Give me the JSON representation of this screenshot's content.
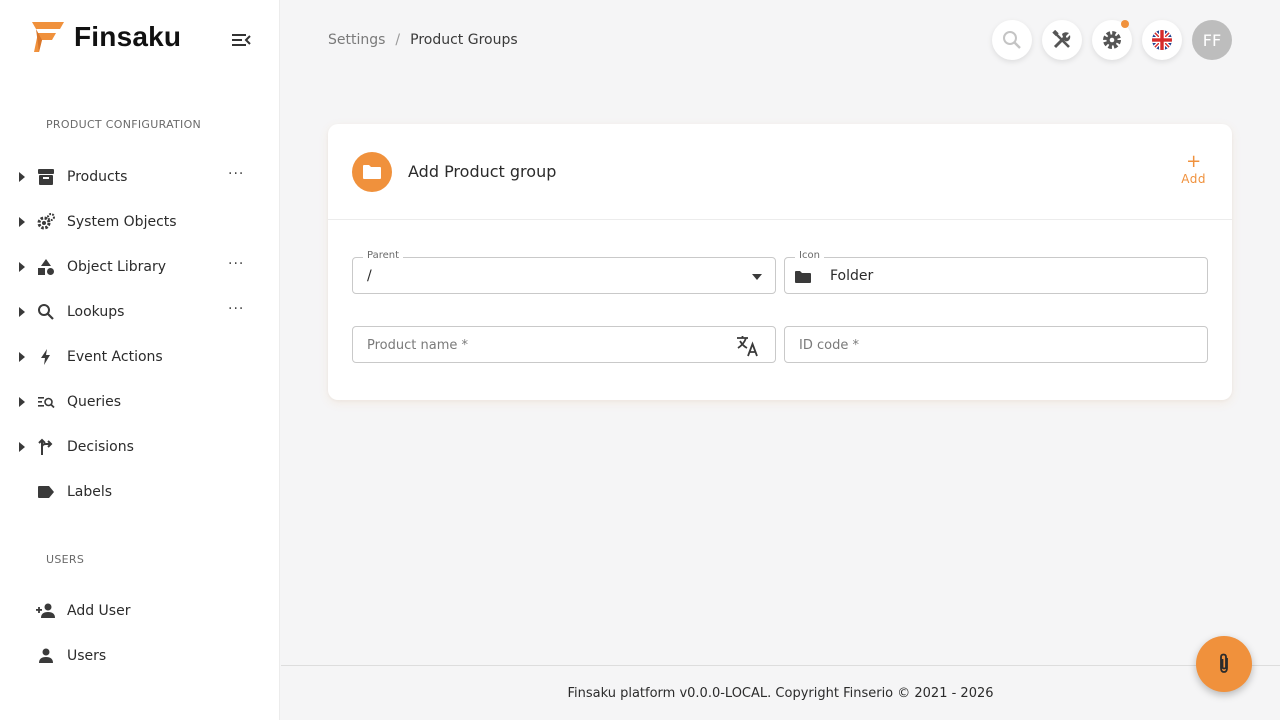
{
  "brand": {
    "name": "Finsaku"
  },
  "sidebar": {
    "sections": [
      {
        "title": "PRODUCT CONFIGURATION"
      },
      {
        "title": "USERS"
      }
    ],
    "items": [
      {
        "label": "Products",
        "icon": "archive-icon",
        "expandable": true,
        "has_more": true
      },
      {
        "label": "System Objects",
        "icon": "gears-icon",
        "expandable": true,
        "has_more": false
      },
      {
        "label": "Object Library",
        "icon": "shapes-icon",
        "expandable": true,
        "has_more": true
      },
      {
        "label": "Lookups",
        "icon": "search-icon",
        "expandable": true,
        "has_more": true
      },
      {
        "label": "Event Actions",
        "icon": "bolt-icon",
        "expandable": true,
        "has_more": false
      },
      {
        "label": "Queries",
        "icon": "query-list-icon",
        "expandable": true,
        "has_more": false
      },
      {
        "label": "Decisions",
        "icon": "fork-arrow-icon",
        "expandable": true,
        "has_more": false
      },
      {
        "label": "Labels",
        "icon": "label-tag-icon",
        "expandable": false,
        "has_more": false
      }
    ],
    "user_items": [
      {
        "label": "Add User",
        "icon": "add-user-icon"
      },
      {
        "label": "Users",
        "icon": "person-icon"
      }
    ],
    "more_glyph": "···"
  },
  "breadcrumb": {
    "parent": "Settings",
    "separator": "/",
    "current": "Product Groups"
  },
  "header": {
    "avatar_initials": "FF"
  },
  "card": {
    "title": "Add Product group",
    "add_label": "Add",
    "add_plus": "+",
    "fields": {
      "parent": {
        "legend": "Parent",
        "value": "/"
      },
      "icon": {
        "legend": "Icon",
        "value": "Folder"
      },
      "product_name": {
        "placeholder": "Product name *"
      },
      "id_code": {
        "placeholder": "ID code *"
      }
    }
  },
  "footer": {
    "text": "Finsaku platform v0.0.0-LOCAL. Copyright Finserio © 2021 - 2026"
  },
  "colors": {
    "accent": "#f0913c",
    "text": "#2b2b2b",
    "muted": "#7a7a7a",
    "background": "#f5f5f6"
  }
}
